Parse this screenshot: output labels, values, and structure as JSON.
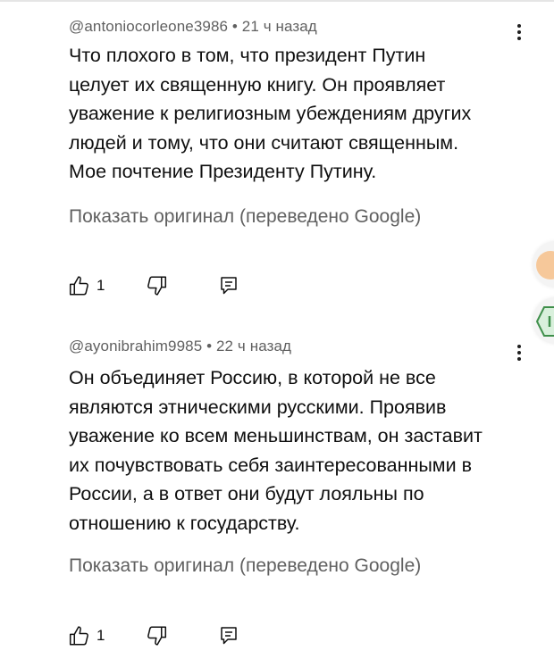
{
  "comments": [
    {
      "author": "@antoniocorleone3986",
      "time": "21 ч назад",
      "text_lines": [
        "Что плохого в том, что президент Путин",
        "целует их священную книгу. Он проявляет",
        "уважение к религиозным убеждениям других",
        "людей и тому, что они считают священным.",
        "Мое почтение Президенту Путину."
      ],
      "translate_label": "Показать оригинал (переведено Google)",
      "likes": "1"
    },
    {
      "author": "@ayonibrahim9985",
      "time": "22 ч назад",
      "text_lines": [
        "Он объединяет Россию, в которой не все",
        "являются этническими русскими. Проявив",
        "уважение ко всем меньшинствам, он заставит",
        "их почувствовать себя заинтересованными в",
        "России, а в ответ они будут лояльны по",
        "отношению к государству."
      ],
      "translate_label": "Показать оригинал (переведено Google)",
      "likes": "1"
    }
  ],
  "separator": "•",
  "icons": {
    "like": "thumb-up-icon",
    "dislike": "thumb-down-icon",
    "reply": "reply-icon",
    "menu": "more-vert-icon"
  },
  "colors": {
    "meta": "#606060",
    "text": "#0f0f0f",
    "edge_orange": "#f6c89a",
    "edge_green": "#3f8f4b"
  }
}
